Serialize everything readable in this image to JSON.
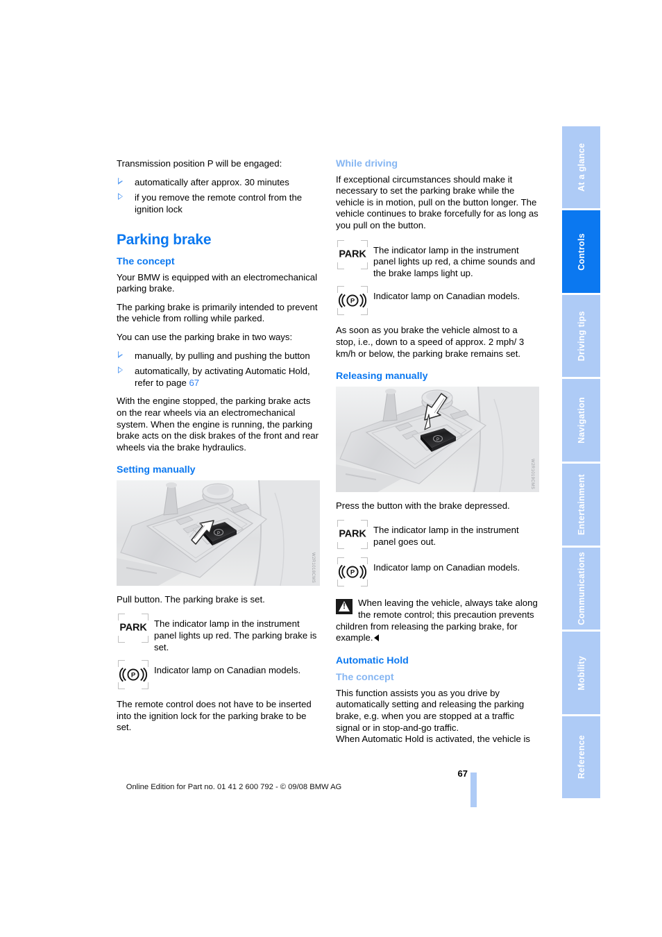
{
  "document": {
    "page_number": "67",
    "footer": "Online Edition for Part no. 01 41 2 600 792 - © 09/08 BMW AG"
  },
  "side_tabs": {
    "active": "Controls",
    "items": [
      {
        "label": "At a glance",
        "active": false
      },
      {
        "label": "Controls",
        "active": true
      },
      {
        "label": "Driving tips",
        "active": false
      },
      {
        "label": "Navigation",
        "active": false
      },
      {
        "label": "Entertainment",
        "active": false
      },
      {
        "label": "Communications",
        "active": false
      },
      {
        "label": "Mobility",
        "active": false
      },
      {
        "label": "Reference",
        "active": false
      }
    ]
  },
  "colors": {
    "heading_blue": "#0b78f0",
    "subheading_light_blue": "#86b6f2",
    "tab_inactive": "#aecbf6",
    "tab_active": "#0b78f0",
    "link_blue": "#2f7ff0"
  },
  "left_column": {
    "intro_lead": "Transmission position P will be engaged:",
    "intro_bullets": [
      "automatically after approx. 30 minutes",
      "if you remove the remote control from the ignition lock"
    ],
    "title": "Parking brake",
    "concept_heading": "The concept",
    "concept_p1": "Your BMW is equipped with an electromechanical parking brake.",
    "concept_p2": "The parking brake is primarily intended to prevent the vehicle from rolling while parked.",
    "concept_p3": "You can use the parking brake in two ways:",
    "concept_bullets_1": "manually, by pulling and pushing the button",
    "concept_bullets_2_pre": "automatically, by activating Automatic Hold, refer to page ",
    "concept_bullets_2_ref": "67",
    "concept_p4": "With the engine stopped, the parking brake acts on the rear wheels via an electromechanical system. When the engine is running, the parking brake acts on the disk brakes of the front and rear wheels via the brake hydraulics.",
    "setting_heading": "Setting manually",
    "illustration_watermark": "W2R1018CMS",
    "setting_caption": "Pull button. The parking brake is set.",
    "lamp_park_glyph": "PARK",
    "lamp_park_text": "The indicator lamp in the instrument panel lights up red. The parking brake is set.",
    "lamp_canada_glyph": "((P))",
    "lamp_canada_text": "Indicator lamp on Canadian models.",
    "closing_p": "The remote control does not have to be inserted into the ignition lock for the parking brake to be set."
  },
  "right_column": {
    "while_driving_heading": "While driving",
    "while_driving_p1": "If exceptional circumstances should make it necessary to set the parking brake while the vehicle is in motion, pull on the button longer. The vehicle continues to brake forcefully for as long as you pull on the button.",
    "lamp_park_glyph": "PARK",
    "lamp_park_text": "The indicator lamp in the instrument panel lights up red, a chime sounds and the brake lamps light up.",
    "lamp_canada_glyph": "((P))",
    "lamp_canada_text": "Indicator lamp on Canadian models.",
    "while_driving_p2": "As soon as you brake the vehicle almost to a stop, i.e., down to a speed of approx. 2 mph/ 3 km/h or below, the parking brake remains set.",
    "releasing_heading": "Releasing manually",
    "illustration_watermark": "W2R1019CMS",
    "releasing_caption": "Press the button with the brake depressed.",
    "release_lamp_park_glyph": "PARK",
    "release_lamp_park_text": "The indicator lamp  in the instrument panel goes out.",
    "release_lamp_canada_glyph": "((P))",
    "release_lamp_canada_text": "Indicator lamp on Canadian models.",
    "warning_text": "When leaving the vehicle, always take along the remote control; this precaution prevents children from releasing the parking brake, for example.",
    "automatic_hold_heading": "Automatic Hold",
    "automatic_hold_concept_heading": "The concept",
    "automatic_hold_p1": "This function assists you as you drive by automatically setting and releasing the parking brake, e.g. when you are stopped at a traffic signal or in stop-and-go traffic.",
    "automatic_hold_p2": "When Automatic Hold is activated, the vehicle is"
  }
}
